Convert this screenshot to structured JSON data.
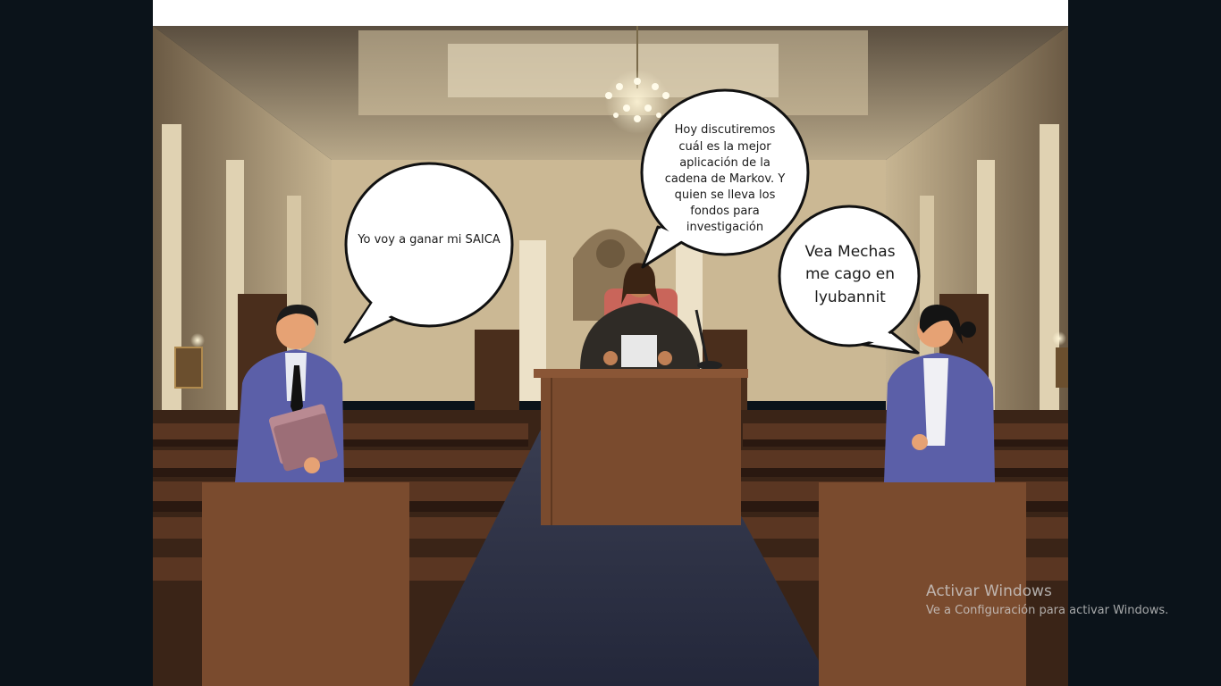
{
  "scene": {
    "setting": "courtroom",
    "bubbles": {
      "lawyer_left": "Yo voy a ganar mi SAICA",
      "judge": "Hoy discutiremos cuál es la mejor aplicación de la cadena de Markov. Y quien se lleva los fondos para investigación",
      "lawyer_right": "Vea Mechas me cago en lyubannit"
    }
  },
  "watermark": {
    "title": "Activar Windows",
    "subtitle": "Ve a Configuración para activar Windows."
  },
  "colors": {
    "podium": "#7a4b2e",
    "suit": "#5b5fa8",
    "robe": "#2f2b26",
    "background": "#0b131a"
  }
}
